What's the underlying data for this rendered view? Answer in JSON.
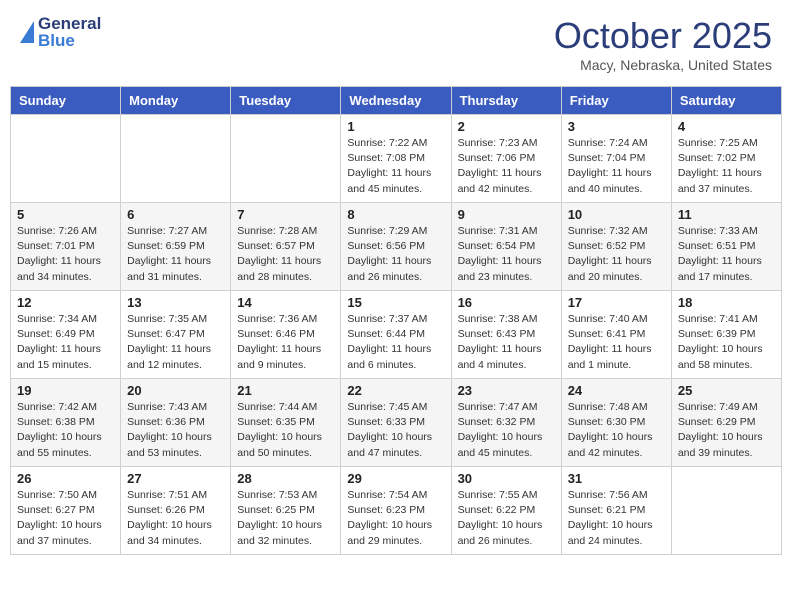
{
  "header": {
    "logo_line1": "General",
    "logo_line2": "Blue",
    "month_title": "October 2025",
    "location": "Macy, Nebraska, United States"
  },
  "calendar": {
    "days_of_week": [
      "Sunday",
      "Monday",
      "Tuesday",
      "Wednesday",
      "Thursday",
      "Friday",
      "Saturday"
    ],
    "weeks": [
      [
        {
          "day": "",
          "info": ""
        },
        {
          "day": "",
          "info": ""
        },
        {
          "day": "",
          "info": ""
        },
        {
          "day": "1",
          "info": "Sunrise: 7:22 AM\nSunset: 7:08 PM\nDaylight: 11 hours\nand 45 minutes."
        },
        {
          "day": "2",
          "info": "Sunrise: 7:23 AM\nSunset: 7:06 PM\nDaylight: 11 hours\nand 42 minutes."
        },
        {
          "day": "3",
          "info": "Sunrise: 7:24 AM\nSunset: 7:04 PM\nDaylight: 11 hours\nand 40 minutes."
        },
        {
          "day": "4",
          "info": "Sunrise: 7:25 AM\nSunset: 7:02 PM\nDaylight: 11 hours\nand 37 minutes."
        }
      ],
      [
        {
          "day": "5",
          "info": "Sunrise: 7:26 AM\nSunset: 7:01 PM\nDaylight: 11 hours\nand 34 minutes."
        },
        {
          "day": "6",
          "info": "Sunrise: 7:27 AM\nSunset: 6:59 PM\nDaylight: 11 hours\nand 31 minutes."
        },
        {
          "day": "7",
          "info": "Sunrise: 7:28 AM\nSunset: 6:57 PM\nDaylight: 11 hours\nand 28 minutes."
        },
        {
          "day": "8",
          "info": "Sunrise: 7:29 AM\nSunset: 6:56 PM\nDaylight: 11 hours\nand 26 minutes."
        },
        {
          "day": "9",
          "info": "Sunrise: 7:31 AM\nSunset: 6:54 PM\nDaylight: 11 hours\nand 23 minutes."
        },
        {
          "day": "10",
          "info": "Sunrise: 7:32 AM\nSunset: 6:52 PM\nDaylight: 11 hours\nand 20 minutes."
        },
        {
          "day": "11",
          "info": "Sunrise: 7:33 AM\nSunset: 6:51 PM\nDaylight: 11 hours\nand 17 minutes."
        }
      ],
      [
        {
          "day": "12",
          "info": "Sunrise: 7:34 AM\nSunset: 6:49 PM\nDaylight: 11 hours\nand 15 minutes."
        },
        {
          "day": "13",
          "info": "Sunrise: 7:35 AM\nSunset: 6:47 PM\nDaylight: 11 hours\nand 12 minutes."
        },
        {
          "day": "14",
          "info": "Sunrise: 7:36 AM\nSunset: 6:46 PM\nDaylight: 11 hours\nand 9 minutes."
        },
        {
          "day": "15",
          "info": "Sunrise: 7:37 AM\nSunset: 6:44 PM\nDaylight: 11 hours\nand 6 minutes."
        },
        {
          "day": "16",
          "info": "Sunrise: 7:38 AM\nSunset: 6:43 PM\nDaylight: 11 hours\nand 4 minutes."
        },
        {
          "day": "17",
          "info": "Sunrise: 7:40 AM\nSunset: 6:41 PM\nDaylight: 11 hours\nand 1 minute."
        },
        {
          "day": "18",
          "info": "Sunrise: 7:41 AM\nSunset: 6:39 PM\nDaylight: 10 hours\nand 58 minutes."
        }
      ],
      [
        {
          "day": "19",
          "info": "Sunrise: 7:42 AM\nSunset: 6:38 PM\nDaylight: 10 hours\nand 55 minutes."
        },
        {
          "day": "20",
          "info": "Sunrise: 7:43 AM\nSunset: 6:36 PM\nDaylight: 10 hours\nand 53 minutes."
        },
        {
          "day": "21",
          "info": "Sunrise: 7:44 AM\nSunset: 6:35 PM\nDaylight: 10 hours\nand 50 minutes."
        },
        {
          "day": "22",
          "info": "Sunrise: 7:45 AM\nSunset: 6:33 PM\nDaylight: 10 hours\nand 47 minutes."
        },
        {
          "day": "23",
          "info": "Sunrise: 7:47 AM\nSunset: 6:32 PM\nDaylight: 10 hours\nand 45 minutes."
        },
        {
          "day": "24",
          "info": "Sunrise: 7:48 AM\nSunset: 6:30 PM\nDaylight: 10 hours\nand 42 minutes."
        },
        {
          "day": "25",
          "info": "Sunrise: 7:49 AM\nSunset: 6:29 PM\nDaylight: 10 hours\nand 39 minutes."
        }
      ],
      [
        {
          "day": "26",
          "info": "Sunrise: 7:50 AM\nSunset: 6:27 PM\nDaylight: 10 hours\nand 37 minutes."
        },
        {
          "day": "27",
          "info": "Sunrise: 7:51 AM\nSunset: 6:26 PM\nDaylight: 10 hours\nand 34 minutes."
        },
        {
          "day": "28",
          "info": "Sunrise: 7:53 AM\nSunset: 6:25 PM\nDaylight: 10 hours\nand 32 minutes."
        },
        {
          "day": "29",
          "info": "Sunrise: 7:54 AM\nSunset: 6:23 PM\nDaylight: 10 hours\nand 29 minutes."
        },
        {
          "day": "30",
          "info": "Sunrise: 7:55 AM\nSunset: 6:22 PM\nDaylight: 10 hours\nand 26 minutes."
        },
        {
          "day": "31",
          "info": "Sunrise: 7:56 AM\nSunset: 6:21 PM\nDaylight: 10 hours\nand 24 minutes."
        },
        {
          "day": "",
          "info": ""
        }
      ]
    ]
  }
}
